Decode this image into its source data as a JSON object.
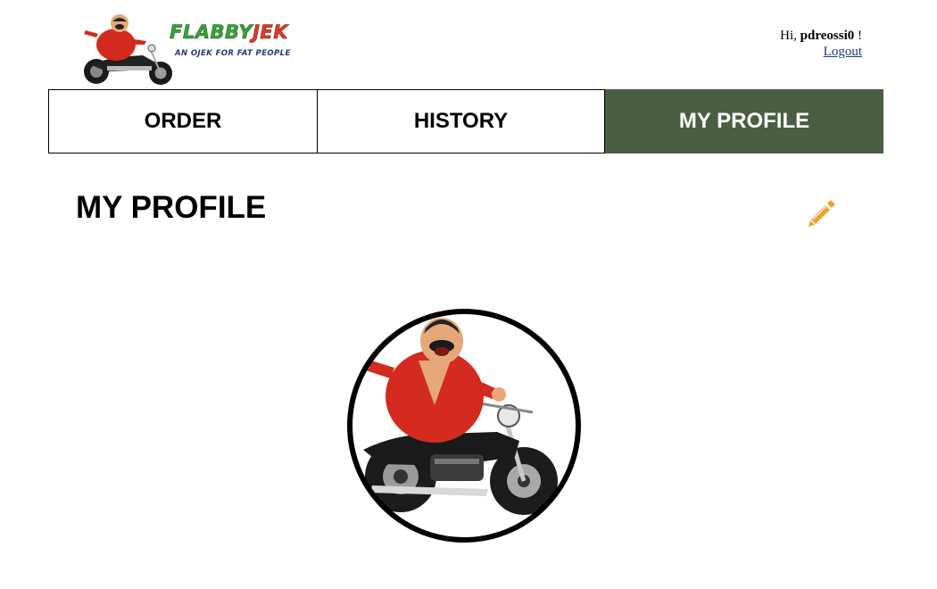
{
  "brand": {
    "name_part1": "FLABBY",
    "name_part2": "JEK",
    "tagline": "AN OJEK FOR FAT PEOPLE",
    "logo_icon": "fat-man-on-motorcycle"
  },
  "user": {
    "greeting_prefix": "Hi, ",
    "username": "pdreossi0",
    "greeting_suffix": " !",
    "logout_label": "Logout"
  },
  "nav": {
    "tabs": [
      {
        "label": "ORDER",
        "active": false
      },
      {
        "label": "HISTORY",
        "active": false
      },
      {
        "label": "MY PROFILE",
        "active": true
      }
    ]
  },
  "page": {
    "title": "MY PROFILE",
    "edit_icon": "pencil-icon"
  },
  "colors": {
    "active_tab_bg": "#4a5e42",
    "edit_icon": "#f0a030",
    "brand_green": "#3aa23a",
    "brand_red": "#e03a2a",
    "tagline_blue": "#1f3b78",
    "link": "#1a3a8a"
  }
}
